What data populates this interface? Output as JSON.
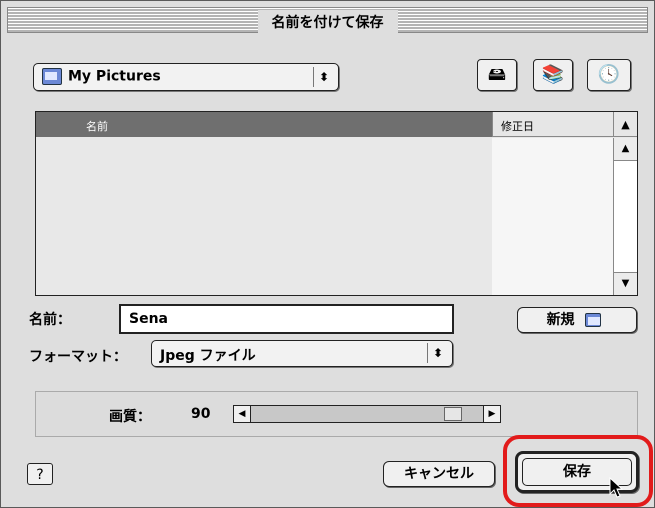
{
  "window": {
    "title": "名前を付けて保存"
  },
  "location": {
    "folder": "My Pictures"
  },
  "list": {
    "col_name": "名前",
    "col_date": "修正日"
  },
  "name_field": {
    "label": "名前：",
    "value": "Sena"
  },
  "new_button": {
    "label": "新規"
  },
  "format": {
    "label": "フォーマット：",
    "value": "Jpeg ファイル"
  },
  "quality": {
    "label": "画質：",
    "value": "90"
  },
  "buttons": {
    "cancel": "キャンセル",
    "save": "保存"
  },
  "help": {
    "label": "?"
  },
  "accent": {
    "highlight": "#e21b1b"
  }
}
